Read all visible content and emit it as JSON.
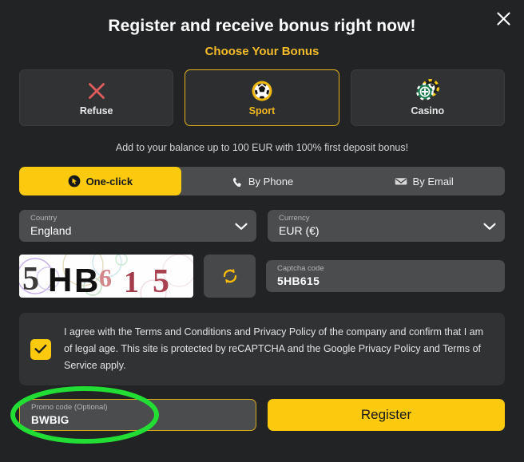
{
  "modal": {
    "title": "Register and receive bonus right now!",
    "subtitle": "Choose Your Bonus",
    "close_icon": "close-icon",
    "bonus_offer_text": "Add to your balance up to 100 EUR with 100% first deposit bonus!"
  },
  "bonus_options": [
    {
      "label": "Refuse",
      "icon": "x-mark-icon",
      "selected": false
    },
    {
      "label": "Sport",
      "icon": "soccer-ball-icon",
      "selected": true
    },
    {
      "label": "Casino",
      "icon": "casino-chips-icon",
      "selected": false
    }
  ],
  "method_tabs": [
    {
      "label": "One-click",
      "icon": "one-click-icon",
      "active": true
    },
    {
      "label": "By Phone",
      "icon": "phone-icon",
      "active": false
    },
    {
      "label": "By Email",
      "icon": "envelope-icon",
      "active": false
    }
  ],
  "fields": {
    "country": {
      "label": "Country",
      "value": "England"
    },
    "currency": {
      "label": "Currency",
      "value": "EUR (€)"
    },
    "captcha": {
      "label": "Captcha code",
      "value": "5HB615"
    },
    "promo": {
      "label": "Promo code (Optional)",
      "value": "BWBIG"
    }
  },
  "captcha_image": {
    "text": "5HB615",
    "characters": [
      {
        "char": "5",
        "color": "#3d3a3a"
      },
      {
        "char": "H",
        "color": "#111111"
      },
      {
        "char": "B",
        "color": "#111111"
      },
      {
        "char": "6",
        "color": "#d4868a"
      },
      {
        "char": "1",
        "color": "#a33b4a"
      },
      {
        "char": "5",
        "color": "#a8424f"
      }
    ]
  },
  "terms": {
    "checked": true,
    "text": "I agree with the Terms and Conditions and Privacy Policy of the company and confirm that I am of legal age. This site is protected by reCAPTCHA and the Google Privacy Policy and Terms of Service apply."
  },
  "actions": {
    "register_label": "Register",
    "refresh_icon": "refresh-icon"
  },
  "annotation": {
    "shape": "ellipse",
    "color": "#22dd33",
    "target": "promo-code-field"
  },
  "colors": {
    "background": "#212325",
    "accent_yellow": "#fbc90d",
    "subtitle_yellow": "#f5bc2a",
    "panel": "#303234",
    "input": "#4a4c4e",
    "refuse_red": "#e05c5c",
    "annotation_green": "#22dd33"
  }
}
